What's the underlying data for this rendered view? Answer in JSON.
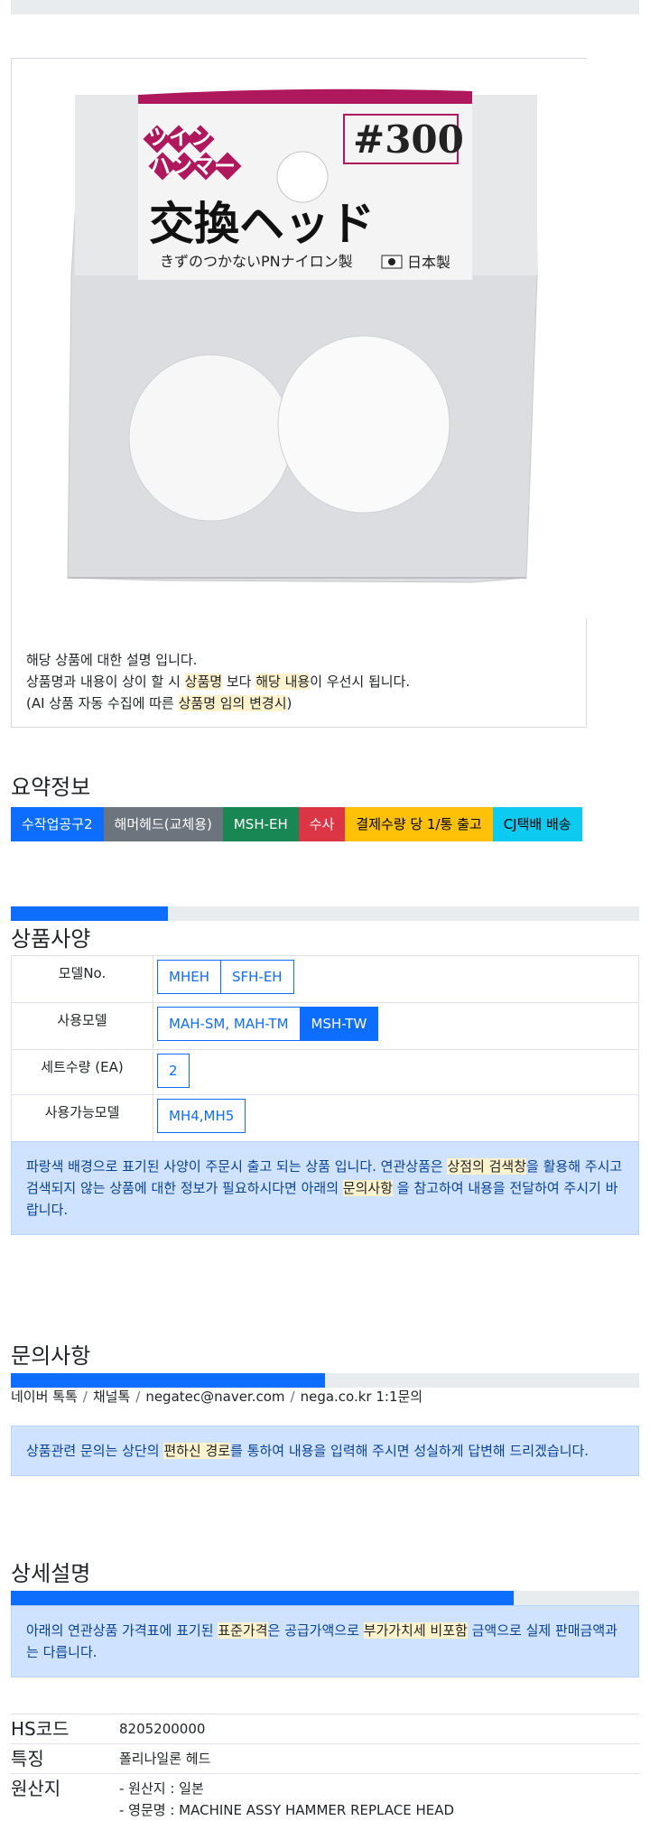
{
  "product_description": {
    "line1": "해당 상품에 대한 설명 입니다.",
    "line2_pre": "상품명과 내용이 상이 할 시",
    "line2_hl1": "상품명",
    "line2_mid": "보다",
    "line2_hl2": "해당 내용",
    "line2_post": "이 우선시 됩니다.",
    "line3_pre": "(AI 상품 자동 수집에 따른",
    "line3_hl": "상품명 임의 변경시",
    "line3_post": ")"
  },
  "package": {
    "brand_line1": "ツイン",
    "brand_line2": "ハンマー",
    "size": "#300",
    "title": "交換ヘッド",
    "subtitle": "きずのつかないPNナイロン製",
    "origin": "日本製"
  },
  "summary": {
    "heading": "요약정보",
    "badges": [
      {
        "label": "수작업공구2",
        "color": "#0d6efd",
        "text_color": "#ffffff"
      },
      {
        "label": "해머헤드(교체용)",
        "color": "#6c757d",
        "text_color": "#ffffff"
      },
      {
        "label": "MSH-EH",
        "color": "#198754",
        "text_color": "#ffffff"
      },
      {
        "label": "수사",
        "color": "#dc3545",
        "text_color": "#ffffff"
      },
      {
        "label": "결제수량 당 1/통 출고",
        "color": "#ffc107",
        "text_color": "#000000"
      },
      {
        "label": "CJ택배 배송",
        "color": "#0dcaf0",
        "text_color": "#000000"
      }
    ]
  },
  "specs": {
    "heading": "상품사양",
    "progress": 0.25,
    "rows": [
      {
        "label": "모델No.",
        "options": [
          {
            "text": "MHEH",
            "selected": false
          },
          {
            "text": "SFH-EH",
            "selected": false
          }
        ]
      },
      {
        "label": "사용모델",
        "options": [
          {
            "text": "MAH-SM, MAH-TM",
            "selected": false
          },
          {
            "text": "MSH-TW",
            "selected": true
          }
        ]
      },
      {
        "label": "세트수량 (EA)",
        "options": [
          {
            "text": "2",
            "selected": false
          }
        ]
      },
      {
        "label": "사용가능모델",
        "options": [
          {
            "text": "MH4,MH5",
            "selected": false
          }
        ]
      }
    ],
    "notice_pre": "파랑색 배경으로 표기된 사양이 주문시 출고 되는 상품 입니다. 연관상품은",
    "notice_hl1": "상점의 검색창",
    "notice_mid": "을 활용해 주시고 검색되지 않는 상품에 대한 정보가 필요하시다면 아래의",
    "notice_hl2": "문의사항",
    "notice_post": "을 참고하여 내용을 전달하여 주시기 바랍니다."
  },
  "inquiry": {
    "heading": "문의사항",
    "progress": 0.5,
    "links": [
      "네이버 톡톡",
      "채널톡",
      "negatec@naver.com",
      "nega.co.kr 1:1문의"
    ],
    "separator": "/",
    "notice_pre": "상품관련 문의는 상단의",
    "notice_hl": "편하신 경로",
    "notice_post": "를 통하여 내용을 입력해 주시면 성실하게 답변해 드리겠습니다."
  },
  "detail": {
    "heading": "상세설명",
    "progress": 0.8,
    "notice_pre": "아래의 연관상품 가격표에 표기된",
    "notice_hl1": "표준가격",
    "notice_mid": "은 공급가액으로",
    "notice_hl2": "부가가치세 비포함",
    "notice_post": "금액으로 실제 판매금액과는 다릅니다."
  },
  "info_table": {
    "hs_label": "HS코드",
    "hs_value": "8205200000",
    "feature_label": "특징",
    "feature_value": "폴리나일론 헤드",
    "origin_label": "원산지",
    "origin_line1": "- 원산지 : 일본",
    "origin_line2": "- 영문명 : MACHINE ASSY HAMMER REPLACE HEAD"
  }
}
